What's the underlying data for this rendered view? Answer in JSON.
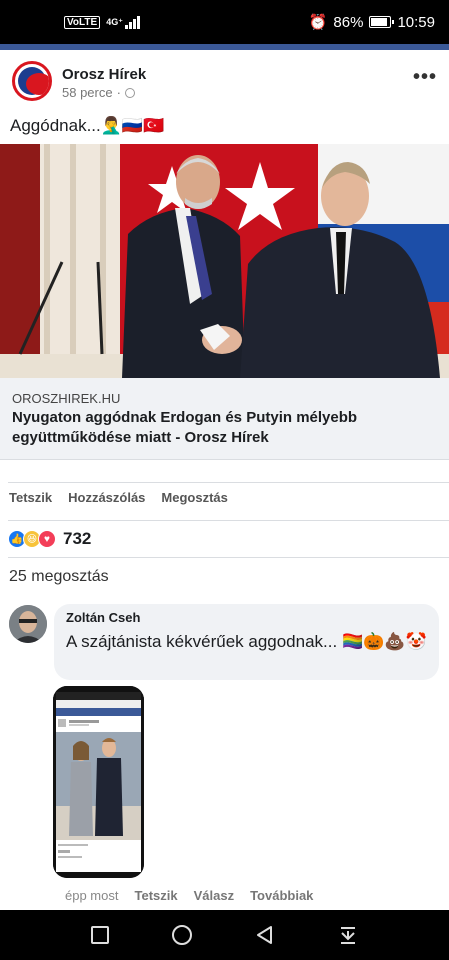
{
  "status": {
    "network": "VoLTE",
    "lte": "4G⁺",
    "battery": "86%",
    "time": "10:59"
  },
  "post": {
    "page_name": "Orosz Hírek",
    "time": "58 perce",
    "more_label": "•••",
    "caption": "Aggódnak...🤦‍♂️🇷🇺🇹🇷",
    "link": {
      "domain": "OROSZHIREK.HU",
      "title": "Nyugaton aggódnak Erdogan és Putyin mélyebb együttműködése miatt - Orosz Hírek"
    },
    "actions": {
      "like": "Tetszik",
      "comment": "Hozzászólás",
      "share": "Megosztás"
    },
    "reactions_count": "732",
    "shares": "25 megosztás"
  },
  "comment": {
    "author": "Zoltán Cseh",
    "text": "A szájtánista kékvérűek aggodnak... 🏳️‍🌈🎃💩🤡",
    "time": "épp most",
    "like": "Tetszik",
    "reply": "Válasz",
    "more": "Továbbiak"
  },
  "colors": {
    "facebook_blue": "#3b5998",
    "like_blue": "#1877f2",
    "bubble_bg": "#f0f2f5"
  }
}
